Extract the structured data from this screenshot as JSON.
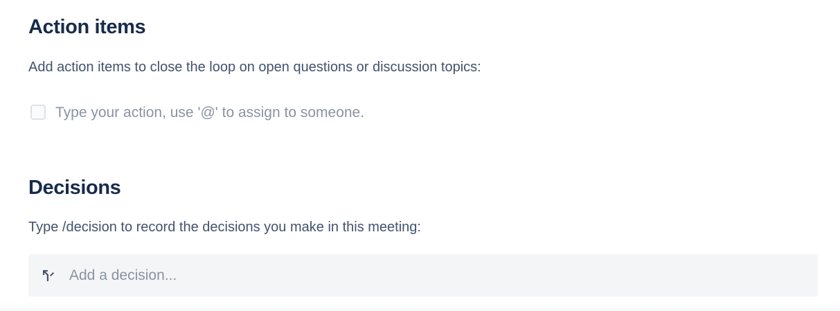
{
  "action_items": {
    "heading": "Action items",
    "description": "Add action items to close the loop on open questions or discussion topics:",
    "task_placeholder": "Type your action, use '@' to assign to someone."
  },
  "decisions": {
    "heading": "Decisions",
    "description": "Type /decision to record the decisions you make in this meeting:",
    "placeholder": "Add a decision...",
    "icon": "decision-icon"
  },
  "colors": {
    "heading": "#172b4d",
    "body_text": "#42526e",
    "placeholder": "#8993a4",
    "decision_box_bg": "#f4f5f7",
    "checkbox_border": "#dfe1e6"
  }
}
